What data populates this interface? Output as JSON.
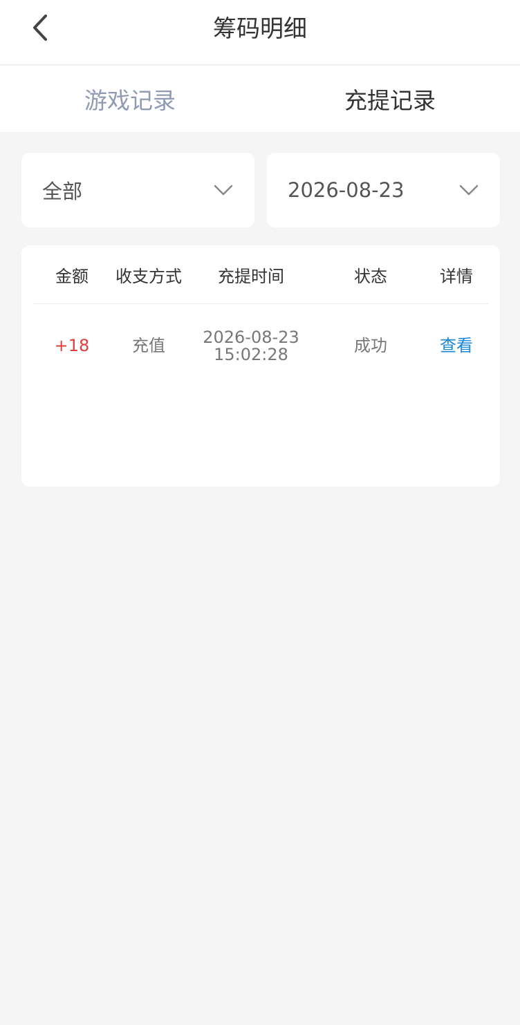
{
  "header": {
    "title": "筹码明细"
  },
  "tabs": [
    {
      "label": "游戏记录",
      "active": false
    },
    {
      "label": "充提记录",
      "active": true
    }
  ],
  "filters": {
    "type": {
      "selected": "全部"
    },
    "date": {
      "selected": "2026-08-23"
    }
  },
  "table": {
    "columns": [
      "金额",
      "收支方式",
      "充提时间",
      "状态",
      "详情"
    ],
    "rows": [
      {
        "amount": "+18",
        "method": "充值",
        "date": "2026-08-23",
        "time": "15:02:28",
        "status": "成功",
        "detail": "查看"
      }
    ]
  },
  "colors": {
    "amount_positive": "#e23b3b",
    "link": "#1a86d6",
    "tab_inactive": "#8f9bb3"
  }
}
